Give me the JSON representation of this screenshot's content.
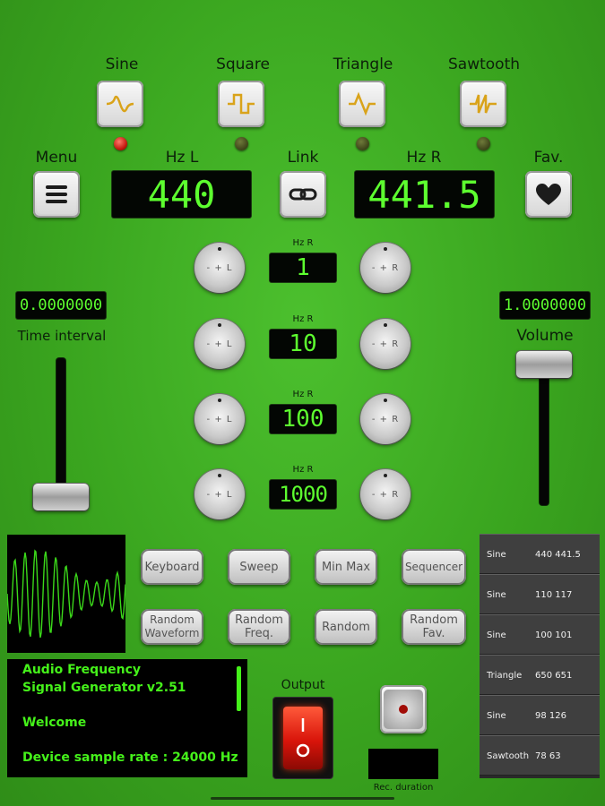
{
  "waveforms": [
    {
      "label": "Sine",
      "active": true
    },
    {
      "label": "Square",
      "active": false
    },
    {
      "label": "Triangle",
      "active": false
    },
    {
      "label": "Sawtooth",
      "active": false
    }
  ],
  "menu_label": "Menu",
  "hz_l_label": "Hz L",
  "hz_l_value": "440",
  "link_label": "Link",
  "hz_r_label": "Hz R",
  "hz_r_value": "441.5",
  "fav_label": "Fav.",
  "steps": [
    {
      "label": "Hz R",
      "value": "1"
    },
    {
      "label": "Hz R",
      "value": "10"
    },
    {
      "label": "Hz R",
      "value": "100"
    },
    {
      "label": "Hz R",
      "value": "1000"
    }
  ],
  "knob_left_text": "- + L",
  "knob_right_text": "- + R",
  "time_interval": {
    "label": "Time interval",
    "value": "0.0000000",
    "level": 0.0
  },
  "volume": {
    "label": "Volume",
    "value": "1.0000000",
    "level": 1.0
  },
  "buttons_row1": [
    "Keyboard",
    "Sweep",
    "Min Max",
    "Sequencer"
  ],
  "buttons_row2": [
    "Random\nWaveform",
    "Random\nFreq.",
    "Random",
    "Random\nFav."
  ],
  "favorites": [
    {
      "wave": "Sine",
      "values": "440 441.5"
    },
    {
      "wave": "Sine",
      "values": "110 117"
    },
    {
      "wave": "Sine",
      "values": "100 101"
    },
    {
      "wave": "Triangle",
      "values": "650 651"
    },
    {
      "wave": "Sine",
      "values": "98 126"
    },
    {
      "wave": "Sawtooth",
      "values": "78 63"
    }
  ],
  "terminal": {
    "line1": "Audio Frequency",
    "line2": "Signal Generator v2.51",
    "line3": "Welcome",
    "line4": "Device sample rate : 24000 Hz"
  },
  "output_label": "Output",
  "rec_duration_label": "Rec. duration",
  "colors": {
    "lcd_text": "#5dff2f",
    "terminal_text": "#45f21a",
    "led_on": "#e0190c",
    "background": "#3aa51f"
  }
}
